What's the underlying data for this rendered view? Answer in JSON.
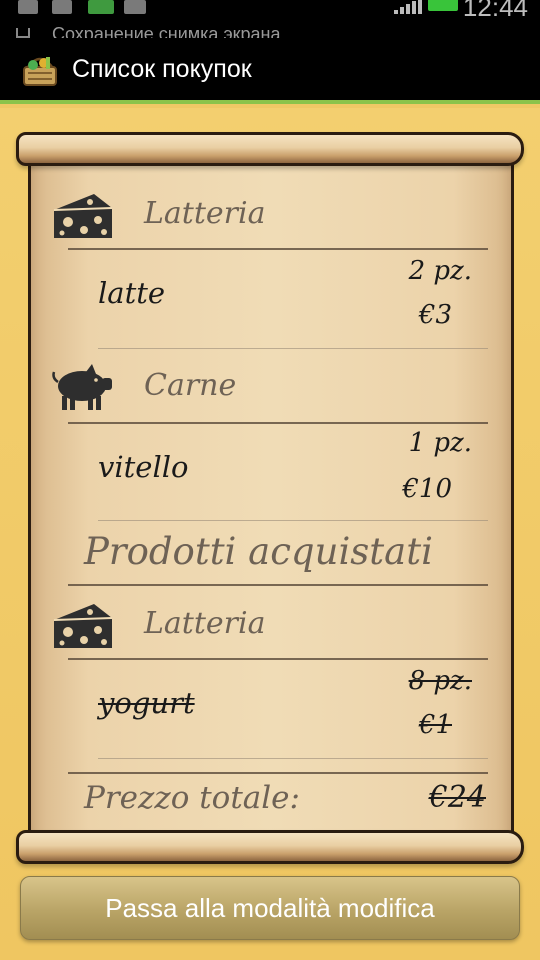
{
  "status_bar": {
    "notification": "Сохранение снимка экрана",
    "time": "12:44"
  },
  "app_bar": {
    "title": "Список покупок",
    "logo_icon": "basket-icon"
  },
  "shopping_list": {
    "pending": [
      {
        "category": "Latteria",
        "category_icon": "cheese-icon",
        "items": [
          {
            "name": "latte",
            "quantity": "2 pz.",
            "price": "€3"
          }
        ]
      },
      {
        "category": "Carne",
        "category_icon": "pig-icon",
        "items": [
          {
            "name": "vitello",
            "quantity": "1 pz.",
            "price": "€10"
          }
        ]
      }
    ],
    "purchased_title": "Prodotti acquistati",
    "purchased": [
      {
        "category": "Latteria",
        "category_icon": "cheese-icon",
        "items": [
          {
            "name": "yogurt",
            "quantity": "8 pz.",
            "price": "€1"
          }
        ]
      }
    ],
    "total_label": "Prezzo totale:",
    "total_value": "€24"
  },
  "action_button": {
    "label": "Passa alla modalità modifica"
  },
  "colors": {
    "background": "#efc865",
    "paper": "#f0dcb6",
    "accent_line": "#8bc34a",
    "header_text": "#6e6255"
  }
}
